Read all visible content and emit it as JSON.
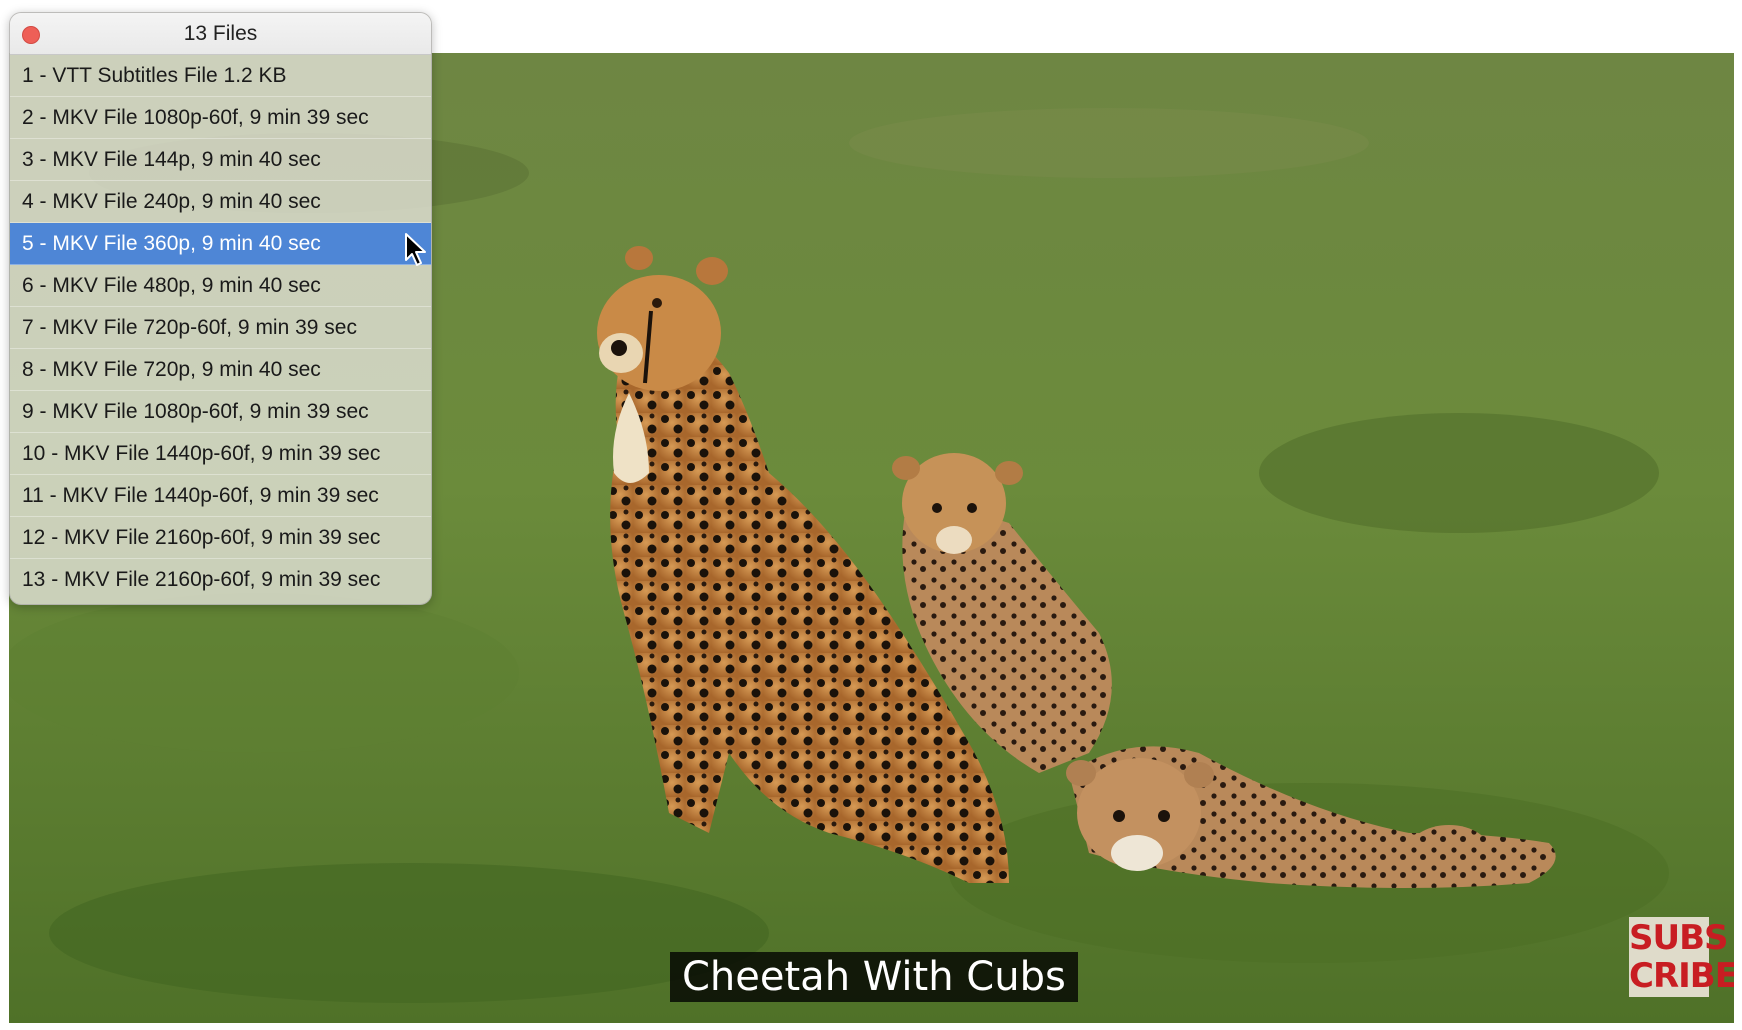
{
  "panel": {
    "title": "13 Files",
    "selected_index": 4,
    "items": [
      {
        "label": "1 - VTT Subtitles File 1.2 KB"
      },
      {
        "label": "2 - MKV File 1080p-60f, 9 min 39 sec"
      },
      {
        "label": "3 - MKV File 144p, 9 min 40 sec"
      },
      {
        "label": "4 - MKV File 240p, 9 min 40 sec"
      },
      {
        "label": "5 - MKV File 360p, 9 min 40 sec"
      },
      {
        "label": "6 - MKV File 480p, 9 min 40 sec"
      },
      {
        "label": "7 - MKV File 720p-60f, 9 min 39 sec"
      },
      {
        "label": "8 - MKV File 720p, 9 min 40 sec"
      },
      {
        "label": "9 - MKV File 1080p-60f, 9 min 39 sec"
      },
      {
        "label": "10 - MKV File 1440p-60f, 9 min 39 sec"
      },
      {
        "label": "11 - MKV File 1440p-60f, 9 min 39 sec"
      },
      {
        "label": "12 - MKV File 2160p-60f, 9 min 39 sec"
      },
      {
        "label": "13 - MKV File 2160p-60f, 9 min 39 sec"
      }
    ]
  },
  "video": {
    "subtitle": "Cheetah With Cubs",
    "logo": {
      "line1": "SUBS",
      "line2": "CRIBE"
    }
  },
  "colors": {
    "selection": "#4e86d6",
    "close_button": "#ee5f57",
    "logo_text": "#c81d22"
  }
}
